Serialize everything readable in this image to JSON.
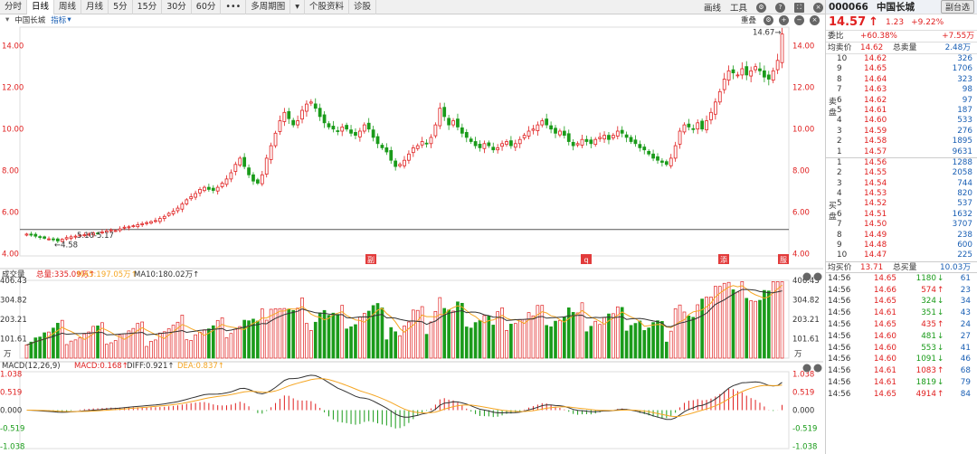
{
  "toolbar": {
    "tabs": [
      "分时",
      "日线",
      "周线",
      "月线",
      "5分",
      "15分",
      "30分",
      "60分",
      "•••",
      "多周期图",
      "▾",
      "个股资料",
      "诊股"
    ],
    "active": 1,
    "right": [
      "画线",
      "工具"
    ]
  },
  "subbar": {
    "name": "中国长城",
    "indicator": "指标",
    "recover": "重叠"
  },
  "quote": {
    "code": "000066",
    "name": "中国长城",
    "button": "副台选",
    "price": "14.57",
    "arrow": "↑",
    "change": "1.23",
    "pct": "+9.22%",
    "weibi_label": "委比",
    "weibi": "+60.38%",
    "weicha": "+7.55万",
    "avg_sell_label": "均卖价",
    "avg_sell": "14.62",
    "total_sell_label": "总卖量",
    "total_sell": "2.48万",
    "sell_side_label": [
      "卖",
      "盘"
    ],
    "sells": [
      {
        "n": "10",
        "p": "14.62",
        "v": "326"
      },
      {
        "n": "9",
        "p": "14.65",
        "v": "1706"
      },
      {
        "n": "8",
        "p": "14.64",
        "v": "323"
      },
      {
        "n": "7",
        "p": "14.63",
        "v": "98"
      },
      {
        "n": "6",
        "p": "14.62",
        "v": "97"
      },
      {
        "n": "5",
        "p": "14.61",
        "v": "187"
      },
      {
        "n": "4",
        "p": "14.60",
        "v": "533"
      },
      {
        "n": "3",
        "p": "14.59",
        "v": "276"
      },
      {
        "n": "2",
        "p": "14.58",
        "v": "1895"
      },
      {
        "n": "1",
        "p": "14.57",
        "v": "9631"
      }
    ],
    "buy_side_label": [
      "买",
      "盘"
    ],
    "buys": [
      {
        "n": "1",
        "p": "14.56",
        "v": "1288"
      },
      {
        "n": "2",
        "p": "14.55",
        "v": "2058"
      },
      {
        "n": "3",
        "p": "14.54",
        "v": "744"
      },
      {
        "n": "4",
        "p": "14.53",
        "v": "820"
      },
      {
        "n": "5",
        "p": "14.52",
        "v": "537"
      },
      {
        "n": "6",
        "p": "14.51",
        "v": "1632"
      },
      {
        "n": "7",
        "p": "14.50",
        "v": "3707"
      },
      {
        "n": "8",
        "p": "14.49",
        "v": "238"
      },
      {
        "n": "9",
        "p": "14.48",
        "v": "600"
      },
      {
        "n": "10",
        "p": "14.47",
        "v": "225"
      }
    ],
    "avg_buy_label": "均买价",
    "avg_buy": "13.71",
    "total_buy_label": "总买量",
    "total_buy": "10.03万",
    "ticks": [
      {
        "t": "14:56",
        "p": "14.65",
        "v": "1180",
        "d": "↓",
        "n": "61"
      },
      {
        "t": "14:56",
        "p": "14.66",
        "v": "574",
        "d": "↑",
        "n": "23"
      },
      {
        "t": "14:56",
        "p": "14.65",
        "v": "324",
        "d": "↓",
        "n": "34"
      },
      {
        "t": "14:56",
        "p": "14.61",
        "v": "351",
        "d": "↓",
        "n": "43"
      },
      {
        "t": "14:56",
        "p": "14.65",
        "v": "435",
        "d": "↑",
        "n": "24"
      },
      {
        "t": "14:56",
        "p": "14.60",
        "v": "481",
        "d": "↓",
        "n": "27"
      },
      {
        "t": "14:56",
        "p": "14.60",
        "v": "553",
        "d": "↓",
        "n": "41"
      },
      {
        "t": "14:56",
        "p": "14.60",
        "v": "1091",
        "d": "↓",
        "n": "46"
      },
      {
        "t": "14:56",
        "p": "14.61",
        "v": "1083",
        "d": "↑",
        "n": "68"
      },
      {
        "t": "14:56",
        "p": "14.61",
        "v": "1819",
        "d": "↓",
        "n": "79"
      },
      {
        "t": "14:56",
        "p": "14.65",
        "v": "4914",
        "d": "↑",
        "n": "84"
      }
    ]
  },
  "chart_data": [
    {
      "type": "candlestick",
      "y_ticks": [
        "14.00",
        "12.00",
        "10.00",
        "8.00",
        "6.00",
        "4.00"
      ],
      "ylim": [
        3.9,
        14.9
      ],
      "annotations": {
        "high": "14.67",
        "low": "4.58",
        "range": "5.10-5.17"
      },
      "markers": [
        "副",
        "q",
        "添",
        "服"
      ],
      "closes": [
        4.95,
        4.9,
        4.85,
        4.8,
        4.75,
        4.72,
        4.68,
        4.62,
        4.7,
        4.78,
        4.82,
        4.85,
        4.9,
        4.92,
        4.95,
        5.0,
        4.98,
        5.05,
        5.1,
        5.15,
        5.12,
        5.2,
        5.28,
        5.3,
        5.35,
        5.4,
        5.45,
        5.5,
        5.55,
        5.6,
        5.7,
        5.8,
        5.95,
        6.05,
        6.2,
        6.4,
        6.6,
        6.75,
        6.9,
        7.1,
        7.2,
        7.1,
        7.05,
        7.2,
        7.4,
        7.6,
        7.9,
        8.3,
        8.6,
        8.2,
        7.8,
        7.5,
        7.4,
        7.8,
        8.6,
        9.2,
        9.8,
        10.4,
        10.8,
        10.5,
        10.2,
        10.4,
        10.9,
        11.2,
        11.3,
        11.0,
        10.6,
        10.3,
        10.1,
        10.0,
        9.9,
        10.1,
        10.0,
        9.8,
        9.7,
        9.9,
        10.2,
        10.0,
        9.6,
        9.3,
        9.1,
        8.9,
        8.5,
        8.2,
        8.3,
        8.5,
        8.8,
        9.1,
        9.2,
        9.4,
        9.3,
        9.6,
        10.2,
        11.0,
        10.6,
        10.2,
        10.4,
        10.1,
        9.8,
        9.6,
        9.4,
        9.2,
        9.1,
        9.3,
        9.2,
        9.0,
        9.1,
        9.3,
        9.4,
        9.2,
        9.3,
        9.5,
        9.7,
        9.9,
        10.0,
        10.2,
        10.4,
        10.2,
        10.0,
        9.8,
        9.9,
        9.7,
        9.4,
        9.2,
        9.3,
        9.5,
        9.4,
        9.3,
        9.5,
        9.6,
        9.7,
        9.5,
        9.7,
        9.9,
        9.8,
        9.6,
        9.4,
        9.3,
        9.1,
        9.0,
        8.8,
        8.6,
        8.5,
        8.4,
        8.3,
        8.6,
        9.2,
        9.9,
        10.2,
        10.1,
        10.0,
        10.3,
        10.0,
        10.4,
        10.8,
        11.3,
        11.8,
        12.4,
        12.8,
        12.7,
        12.6,
        12.9,
        12.6,
        12.8,
        13.0,
        12.8,
        12.5,
        12.4,
        12.8,
        13.3,
        14.57
      ],
      "volume_ylim": [
        0,
        406.43
      ],
      "volume_ticks": [
        "406.43",
        "304.82",
        "203.21",
        "101.61"
      ],
      "volume_unit": "万",
      "volume_legend": {
        "label": "成交量",
        "total": "总量:335.09万",
        "ma5": "MA5:197.05万",
        "ma10": "MA10:180.02万"
      },
      "macd_ylim": [
        -1.1,
        1.1
      ],
      "macd_ticks": [
        "1.038",
        "0.519",
        "0.000",
        "-0.519",
        "-1.038"
      ],
      "macd_legend": {
        "label": "MACD(12,26,9)",
        "macd": "MACD:0.168",
        "diff": "DIFF:0.921",
        "dea": "DEA:0.837"
      }
    }
  ]
}
